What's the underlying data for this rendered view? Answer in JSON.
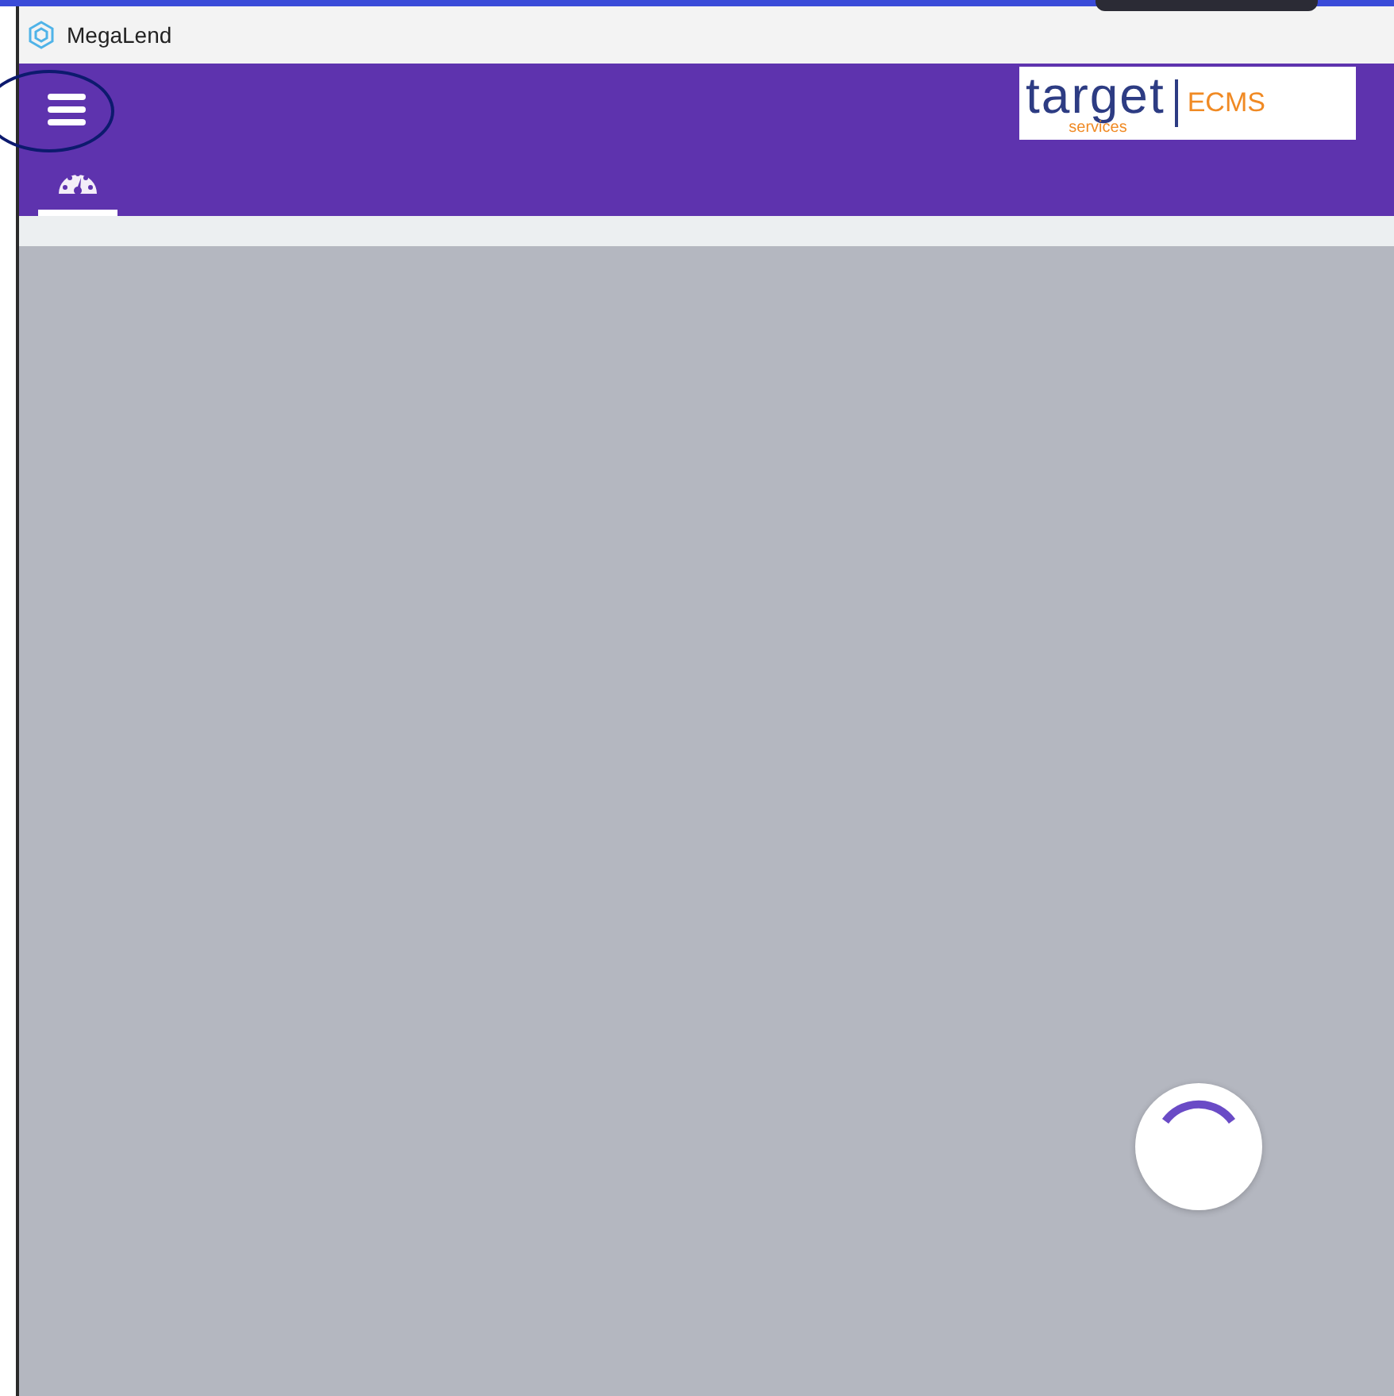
{
  "window": {
    "title": "MegaLend"
  },
  "logo": {
    "word": "target",
    "sub": "services",
    "product": "ECMS"
  },
  "tabs": [
    {
      "kind": "dashboard",
      "selected": true
    }
  ],
  "loading": true
}
